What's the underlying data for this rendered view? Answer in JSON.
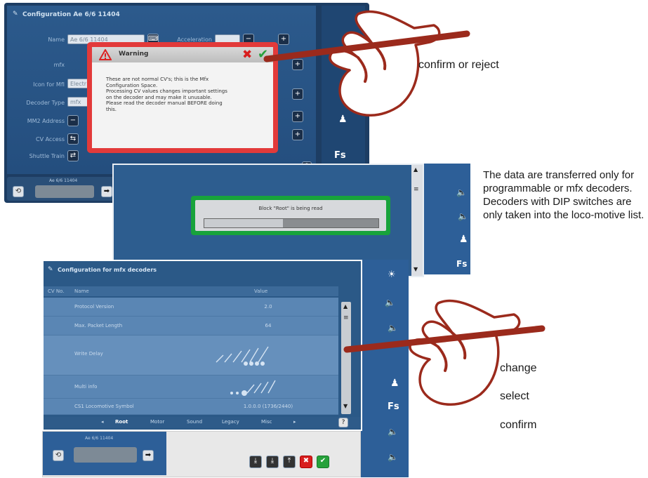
{
  "panel1": {
    "title": "Configuration Ae 6/6 11404",
    "labels": {
      "name": "Name",
      "accel": "Acceleration",
      "mfx": "mfx",
      "icon_for_mfx": "Icon for MfI",
      "decoder_type": "Decoder Type",
      "mm2": "MM2 Address",
      "cv_access": "CV Access",
      "shuttle_train": "Shuttle Train"
    },
    "name_value": "Ae 6/6 11404",
    "decoder_value": "mfx",
    "icon_value": "Electr",
    "loco_bottom": "Ae 6/6 11404"
  },
  "warning": {
    "title": "Warning",
    "text_lines": [
      "These are not normal CV's; this is the Mfx",
      "Configuration Space.",
      "Processing CV values changes important settings",
      "on the decoder and may make it unusable.",
      "Please read the decoder manual BEFORE doing",
      "this."
    ]
  },
  "reading": {
    "message": "Block \"Root\" is being read"
  },
  "mfx_config": {
    "title": "Configuration for mfx decoders",
    "columns": [
      "CV No.",
      "Name",
      "Value"
    ],
    "rows": [
      {
        "name": "Protocol Version",
        "value": "2.0"
      },
      {
        "name": "Max. Packet Length",
        "value": "64"
      },
      {
        "name": "Write Delay",
        "value": ""
      },
      {
        "name": "Multi info",
        "value": ""
      },
      {
        "name": "CS1 Locomotive Symbol",
        "value": "1.0.0.0 (1736/2440)"
      }
    ],
    "tabs": [
      "Root",
      "Motor",
      "Sound",
      "Legacy",
      "Misc"
    ],
    "loco_bottom": "Ae 6/6 11404"
  },
  "annotations": {
    "confirm_or_reject": "confirm or reject",
    "note": "The data are transferred only for programmable or mfx decoders. Decoders with DIP switches are only taken into the loco-motive list.",
    "change": "change",
    "select": "select",
    "confirm": "confirm"
  },
  "colors": {
    "warning_border": "#e23a3a",
    "reading_border": "#18a33b",
    "hand_stylus": "#9b2a1c",
    "screen_blue": "#2c5a8c"
  },
  "read_progress": 0.45
}
